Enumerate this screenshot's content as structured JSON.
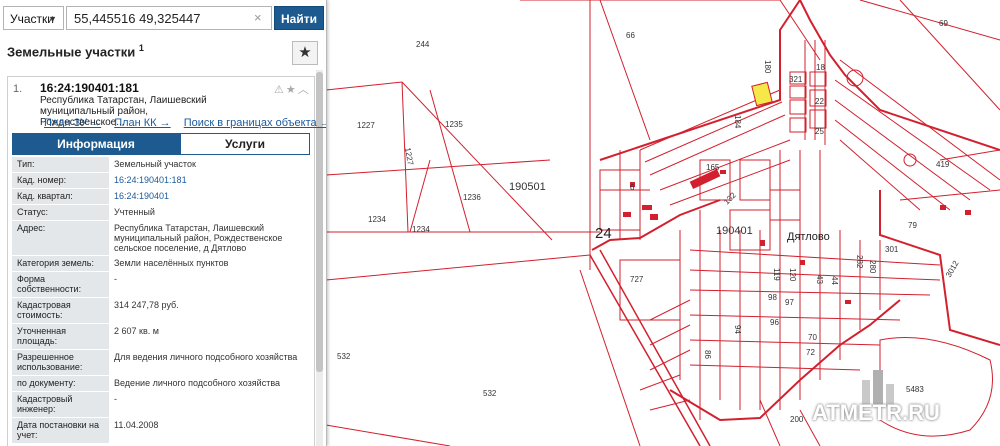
{
  "search": {
    "type_label": "Участки",
    "query": "55,445516 49,325447",
    "find_label": "Найти"
  },
  "panel": {
    "title": "Земельные участки",
    "title_count": "1"
  },
  "result": {
    "index": "1.",
    "cad_number": "16:24:190401:181",
    "address": "Республика Татарстан, Лаишевский муниципальный район, Рождественское...",
    "links": [
      "План ЗУ →",
      "План КК →",
      "Поиск в границах объекта →"
    ],
    "tabs": [
      "Информация",
      "Услуги"
    ]
  },
  "props": [
    {
      "k": "Тип:",
      "v": "Земельный участок"
    },
    {
      "k": "Кад. номер:",
      "v": "16:24:190401:181"
    },
    {
      "k": "Кад. квартал:",
      "v": "16:24:190401"
    },
    {
      "k": "Статус:",
      "v": "Учтенный"
    },
    {
      "k": "Адрес:",
      "v": "Республика Татарстан, Лаишевский муниципальный район, Рождественское сельское поселение, д Дятлово"
    },
    {
      "k": "Категория земель:",
      "v": "Земли населённых пунктов"
    },
    {
      "k": "Форма собственности:",
      "v": "-"
    },
    {
      "k": "Кадастровая стоимость:",
      "v": "314 247,78 руб."
    },
    {
      "k": "Уточненная площадь:",
      "v": "2 607 кв. м"
    },
    {
      "k": "Разрешенное использование:",
      "v": "Для ведения личного подсобного хозяйства"
    },
    {
      "k": "по документу:",
      "v": "Ведение личного подсобного хозяйства"
    },
    {
      "k": "Кадастровый инженер:",
      "v": "-"
    },
    {
      "k": "Дата постановки на учет:",
      "v": "11.04.2008"
    }
  ],
  "map": {
    "line_color": "#d2202e",
    "highlight_color": "#f5e94a",
    "labels": [
      "244",
      "66",
      "69",
      "1227",
      "1235",
      "1227",
      "190501",
      "1236",
      "1234",
      "1234",
      "24",
      "6",
      "727",
      "532",
      "532",
      "190401",
      "Дятлово",
      "79",
      "419",
      "321",
      "18",
      "22",
      "25",
      "180",
      "184",
      "301",
      "3012",
      "5483",
      "200",
      "98",
      "97",
      "96",
      "94",
      "86",
      "72",
      "70",
      "43",
      "44",
      "119",
      "120",
      "282",
      "280",
      "165",
      "132"
    ]
  },
  "watermark": "ATMETR.RU"
}
